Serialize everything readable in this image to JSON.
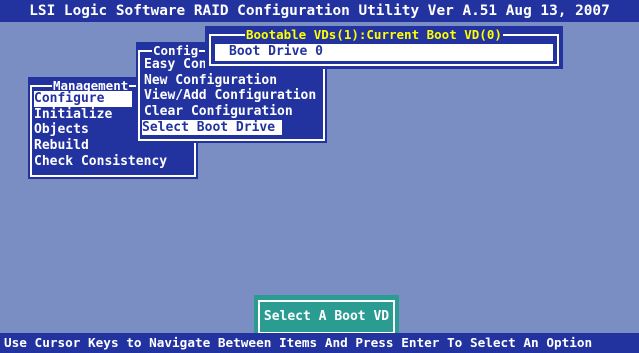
{
  "title": "LSI Logic Software RAID Configuration Utility Ver A.51 Aug 13, 2007",
  "status_bar": "Use Cursor Keys to Navigate Between Items And Press Enter To Select An Option",
  "management_menu": {
    "title": "Management",
    "items": [
      "Configure",
      "Initialize",
      "Objects",
      "Rebuild",
      "Check Consistency"
    ],
    "selected": "Configure"
  },
  "configure_menu": {
    "title": "Config",
    "items": [
      "Easy Con",
      "New Configuration",
      "View/Add Configuration",
      "Clear Configuration",
      "Select Boot Drive"
    ],
    "selected": "Select Boot Drive"
  },
  "boot_dialog": {
    "title": "Bootable VDs(1):Current Boot VD(0)",
    "value": "Boot Drive 0"
  },
  "action_label": "Select A Boot VD",
  "colors": {
    "background": "#7a8ec4",
    "panel": "#2233a0",
    "title_text": "#ffffff",
    "dialog_title": "#ffff00",
    "action_box": "#2a9c92"
  }
}
